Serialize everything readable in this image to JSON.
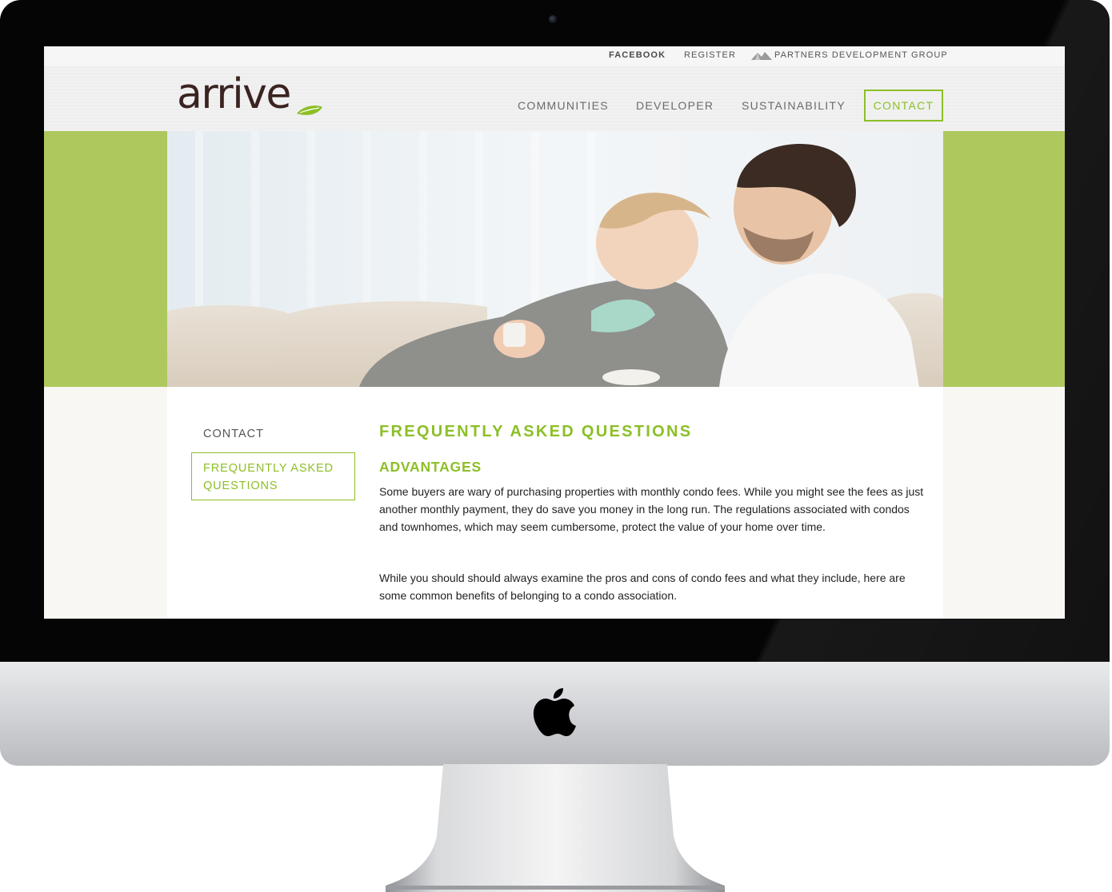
{
  "top_links": {
    "facebook": "FACEBOOK",
    "register": "REGISTER",
    "partners": "PARTNERS DEVELOPMENT GROUP"
  },
  "logo": {
    "text": "arrive"
  },
  "nav": {
    "communities": "COMMUNITIES",
    "developer": "DEVELOPER",
    "sustainability": "SUSTAINABILITY",
    "contact": "CONTACT"
  },
  "sidebar": {
    "contact": "CONTACT",
    "faq_line1": "FREQUENTLY ASKED",
    "faq_line2": "QUESTIONS"
  },
  "main": {
    "title": "FREQUENTLY ASKED QUESTIONS",
    "section_title": "ADVANTAGES",
    "paragraph1": "Some buyers are wary of purchasing properties with monthly condo fees. While you might see the fees as just another monthly payment, they do save you money in the long run. The regulations associated with condos and townhomes, which may seem cumbersome, protect the value of your home over time.",
    "paragraph2": "While you should should always examine the pros and cons of condo fees and what they include, here are some common benefits of belonging to a condo association."
  },
  "colors": {
    "accent": "#8cbf26",
    "hero_band": "#aec85e",
    "logo": "#3a2320"
  },
  "icons": {
    "partners": "partners-mountain-icon",
    "logo_leaf": "leaf-icon",
    "hardware": "apple-logo-icon"
  }
}
